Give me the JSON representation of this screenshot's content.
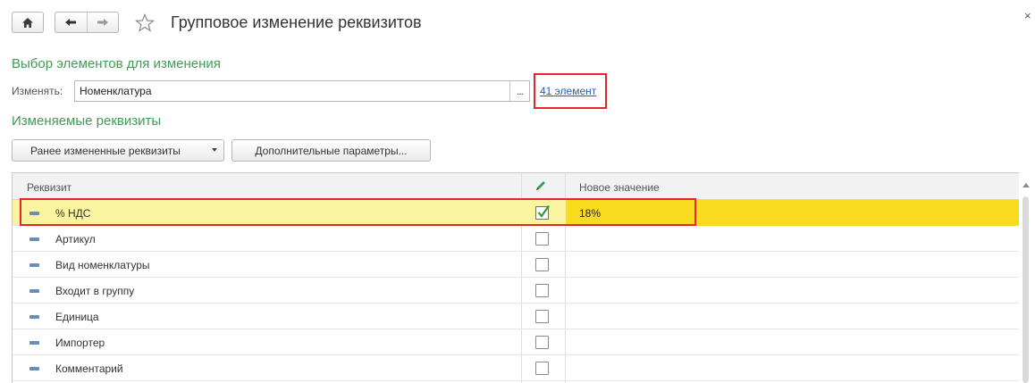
{
  "window": {
    "title": "Групповое изменение реквизитов",
    "close_label": "×"
  },
  "icons": {
    "home": "home-icon",
    "back": "arrow-left-icon",
    "forward": "arrow-right-icon",
    "favorite": "star-icon",
    "edit": "pencil-icon"
  },
  "selection": {
    "heading": "Выбор элементов для изменения",
    "change_label": "Изменять:",
    "field_value": "Номенклатура",
    "field_button": "...",
    "elements_link": "41 элемент"
  },
  "attributes": {
    "heading": "Изменяемые реквизиты",
    "prev_button": "Ранее измененные реквизиты",
    "extra_button": "Дополнительные параметры..."
  },
  "table": {
    "headers": {
      "attribute": "Реквизит",
      "new_value": "Новое значение"
    },
    "rows": [
      {
        "name": "% НДС",
        "checked": true,
        "value": "18%"
      },
      {
        "name": "Артикул",
        "checked": false,
        "value": ""
      },
      {
        "name": "Вид номенклатуры",
        "checked": false,
        "value": ""
      },
      {
        "name": "Входит в группу",
        "checked": false,
        "value": ""
      },
      {
        "name": "Единица",
        "checked": false,
        "value": ""
      },
      {
        "name": "Импортер",
        "checked": false,
        "value": ""
      },
      {
        "name": "Комментарий",
        "checked": false,
        "value": ""
      }
    ]
  },
  "colors": {
    "accent_green": "#3e9c52",
    "link_blue": "#2a5ea8",
    "highlight_red": "#e3262c",
    "selected_row": "#faf3a0",
    "selected_value": "#f9dc1d",
    "check_green": "#2f9a3e"
  }
}
